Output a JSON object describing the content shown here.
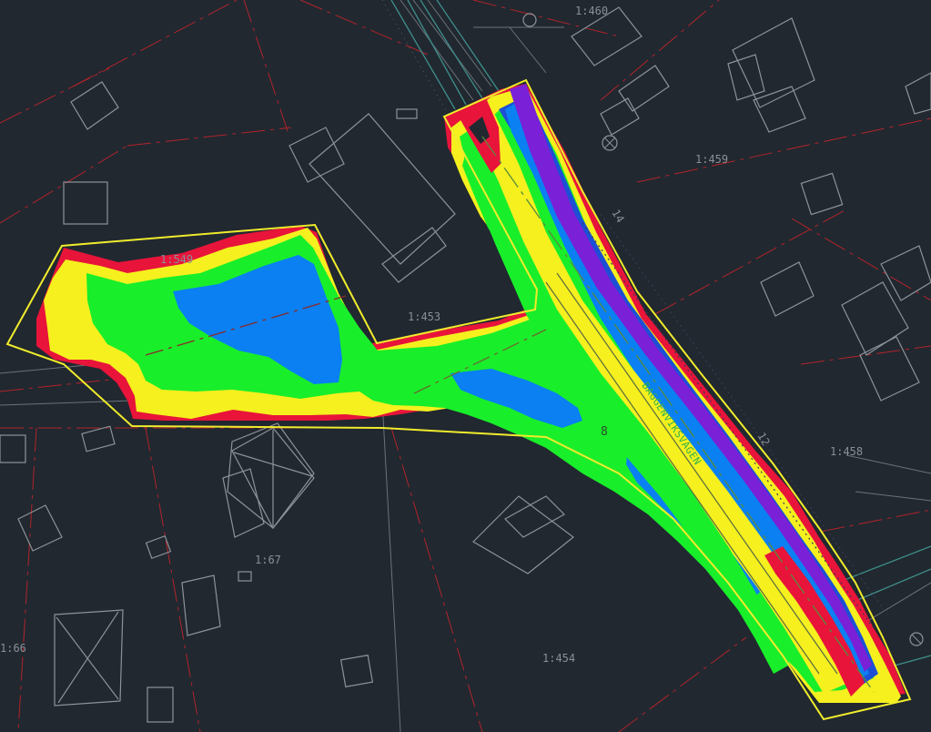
{
  "map": {
    "street_name": "BAGGENVIKSVÄGEN",
    "parcel_labels": [
      "1:460",
      "1:459",
      "1:549",
      "1:453",
      "1:458",
      "1:67",
      "1:66",
      "1:454"
    ],
    "small_marks": [
      "14",
      "12",
      "8"
    ]
  },
  "colors": {
    "background": "#212830",
    "boundary": "#f0ec2c",
    "property_lines": "#b2242a",
    "buildings": "#8d9398",
    "depth_scale": [
      "#e8143a",
      "#f5f01e",
      "#19ee2a",
      "#0a80f2",
      "#1c4fd6",
      "#7a20d6"
    ]
  }
}
